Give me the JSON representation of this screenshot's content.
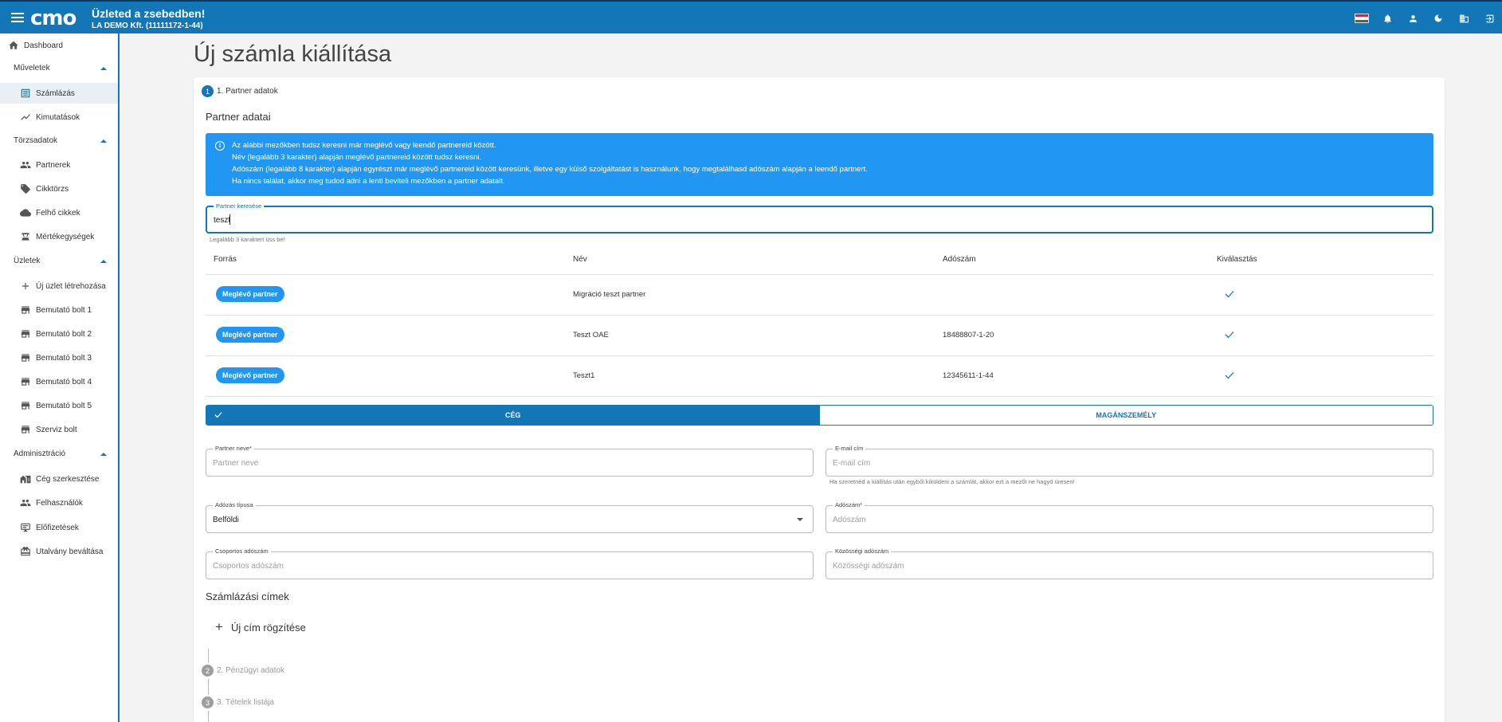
{
  "header": {
    "logo_text": "cmo",
    "title": "Üzleted a zsebedben!",
    "company": "LA DEMO Kft. (11111172-1-44)",
    "icons": [
      "hungarian-flag-icon",
      "bell-icon",
      "person-icon",
      "moon-icon",
      "company-icon",
      "logout-icon"
    ]
  },
  "sidebar": {
    "dashboard": "Dashboard",
    "sections": {
      "muveletek": "Műveletek",
      "torzsadatok": "Törzsadatok",
      "uzletek": "Üzletek",
      "adminisztracio": "Adminisztráció"
    },
    "items": {
      "szamlazas": "Számlázás",
      "kimutatasok": "Kimutatások",
      "partnerek": "Partnerek",
      "cikktorzs": "Cikktörzs",
      "felho_cikkek": "Felhő cikkek",
      "mertekegysegek": "Mértékegységek",
      "uj_uzlet": "Új üzlet létrehozása",
      "bolt1": "Bemutató bolt 1",
      "bolt2": "Bemutató bolt 2",
      "bolt3": "Bemutató bolt 3",
      "bolt4": "Bemutató bolt 4",
      "bolt5": "Bemutató bolt 5",
      "szerviz": "Szerviz bolt",
      "ceg_szerkesztese": "Cég szerkesztése",
      "felhasznalok": "Felhasználók",
      "elofizetesek": "Előfizetések",
      "utalvany": "Utalvány beváltása"
    }
  },
  "page": {
    "title": "Új számla kiállítása",
    "steps": [
      {
        "num": "1",
        "label": "1. Partner adatok"
      },
      {
        "num": "2",
        "label": "2. Pénzügyi adatok"
      },
      {
        "num": "3",
        "label": "3. Tételek listája"
      }
    ],
    "partner_title": "Partner adatai",
    "info_lines": [
      "Az alábbi mezőkben tudsz keresni már meglévő vagy leendő partnereid között.",
      "Név (legalább 3 karakter) alapján meglévő partnereid között tudsz keresni.",
      "Adószám (legalább 8 karakter) alapján egyrészt már meglévő partnereid között keresünk, illetve egy külső szolgáltatást is használunk, hogy megtalálhasd adószám alapján a leendő partnert.",
      "Ha nincs találat, akkor meg tudod adni a lenti beviteli mezőkben a partner adatait."
    ],
    "search": {
      "label": "Partner keresése",
      "value": "teszt",
      "hint": "Legalább 3 karaktert üss be!"
    },
    "table": {
      "headers": [
        "Forrás",
        "Név",
        "Adószám",
        "Kiválasztás"
      ],
      "rows": [
        {
          "source": "Meglévő partner",
          "name": "Migráció teszt partner",
          "tax": ""
        },
        {
          "source": "Meglévő partner",
          "name": "Teszt OAE",
          "tax": "18488807-1-20"
        },
        {
          "source": "Meglévő partner",
          "name": "Teszt1",
          "tax": "12345611-1-44"
        }
      ]
    },
    "toggle": {
      "company": "CÉG",
      "private": "MAGÁNSZEMÉLY",
      "selected": "CÉG"
    },
    "form": {
      "partner_name_label": "Partner neve*",
      "partner_name_placeholder": "Partner neve",
      "email_label": "E-mail cím",
      "email_placeholder": "E-mail cím",
      "email_hint": "Ha szeretnéd a kiállítás után egyből kiküldeni a számlát, akkor ezt a mezőt ne hagyd üresen!",
      "tax_type_label": "Adózás típusa",
      "tax_type_value": "Belföldi",
      "tax_number_label": "Adószám*",
      "tax_number_placeholder": "Adószám",
      "group_tax_label": "Csoportos adószám",
      "group_tax_placeholder": "Csoportos adószám",
      "eu_tax_label": "Közösségi adószám",
      "eu_tax_placeholder": "Közösségi adószám"
    },
    "billing_title": "Számlázási címek",
    "add_address": "Új cím rögzítése"
  },
  "colors": {
    "primary": "#1376b7",
    "info": "#2196f3"
  }
}
